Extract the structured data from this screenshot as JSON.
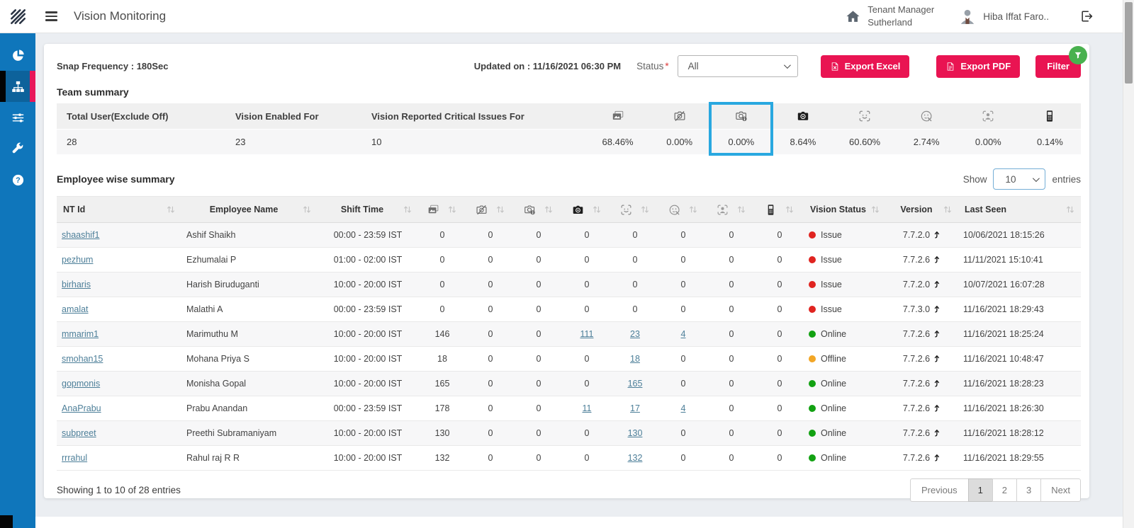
{
  "topbar": {
    "title": "Vision Monitoring",
    "tenant_line1": "Tenant Manager",
    "tenant_line2": "Sutherland",
    "user": "Hiba Iffat Faro.."
  },
  "sidebar": {
    "items": [
      {
        "name": "dashboard",
        "icon": "pie-chart-icon",
        "active": false
      },
      {
        "name": "team-monitoring",
        "icon": "sitemap-icon",
        "active": true
      },
      {
        "name": "configuration",
        "icon": "sliders-icon",
        "active": false
      },
      {
        "name": "tools",
        "icon": "wrench-icon",
        "active": false
      },
      {
        "name": "help",
        "icon": "help-icon",
        "active": false
      }
    ]
  },
  "toolbar": {
    "snap_frequency": "Snap Frequency : 180Sec",
    "updated_on": "Updated on : 11/16/2021 06:30 PM",
    "status_label": "Status",
    "required_mark": "*",
    "status_value": "All",
    "export_excel": "Export Excel",
    "export_pdf": "Export PDF",
    "filter": "Filter"
  },
  "team_summary": {
    "title": "Team summary",
    "columns": [
      {
        "type": "text",
        "label": "Total User(Exclude Off)",
        "value": "28"
      },
      {
        "type": "text",
        "label": "Vision Enabled For",
        "value": "23"
      },
      {
        "type": "text",
        "label": "Vision Reported Critical Issues For",
        "value": "10"
      },
      {
        "type": "icon",
        "icon": "photos-icon",
        "value": "68.46%"
      },
      {
        "type": "icon",
        "icon": "camera-off-icon",
        "value": "0.00%"
      },
      {
        "type": "icon",
        "icon": "camera-info-icon",
        "value": "0.00%",
        "highlighted": true
      },
      {
        "type": "icon",
        "icon": "camera-icon",
        "value": "8.64%"
      },
      {
        "type": "icon",
        "icon": "face-scan-icon",
        "value": "60.60%"
      },
      {
        "type": "icon",
        "icon": "face-issue-icon",
        "value": "2.74%"
      },
      {
        "type": "icon",
        "icon": "person-detect-icon",
        "value": "0.00%"
      },
      {
        "type": "icon",
        "icon": "mobile-icon",
        "value": "0.14%"
      }
    ]
  },
  "employee_table": {
    "title": "Employee wise summary",
    "show_label": "Show",
    "entries_label": "entries",
    "page_size": "10",
    "headers_left": [
      "NT Id",
      "Employee Name",
      "Shift Time"
    ],
    "icon_headers": [
      "photos-icon",
      "camera-off-icon",
      "camera-info-icon",
      "camera-icon",
      "face-scan-icon",
      "face-issue-icon",
      "person-detect-icon",
      "mobile-icon"
    ],
    "headers_right": [
      "Vision Status",
      "Version",
      "Last Seen"
    ],
    "rows": [
      {
        "nt_id": "shaashif1",
        "name": "Ashif Shaikh",
        "shift": "00:00 - 23:59 IST",
        "values": [
          "0",
          "0",
          "0",
          "0",
          "0",
          "0",
          "0",
          "0"
        ],
        "links": [],
        "status": {
          "label": "Issue",
          "state": "issue"
        },
        "version": "7.7.2.0",
        "last_seen": "10/06/2021 18:15:26"
      },
      {
        "nt_id": "pezhum",
        "name": "Ezhumalai P",
        "shift": "01:00 - 02:00 IST",
        "values": [
          "0",
          "0",
          "0",
          "0",
          "0",
          "0",
          "0",
          "0"
        ],
        "links": [],
        "status": {
          "label": "Issue",
          "state": "issue"
        },
        "version": "7.7.2.6",
        "last_seen": "11/11/2021 15:10:41"
      },
      {
        "nt_id": "birharis",
        "name": "Harish Biruduganti",
        "shift": "10:00 - 20:00 IST",
        "values": [
          "0",
          "0",
          "0",
          "0",
          "0",
          "0",
          "0",
          "0"
        ],
        "links": [],
        "status": {
          "label": "Issue",
          "state": "issue"
        },
        "version": "7.7.2.0",
        "last_seen": "10/07/2021 16:07:28"
      },
      {
        "nt_id": "amalat",
        "name": "Malathi A",
        "shift": "00:00 - 23:59 IST",
        "values": [
          "0",
          "0",
          "0",
          "0",
          "0",
          "0",
          "0",
          "0"
        ],
        "links": [],
        "status": {
          "label": "Issue",
          "state": "issue"
        },
        "version": "7.7.3.0",
        "last_seen": "11/16/2021 18:29:43"
      },
      {
        "nt_id": "mmarim1",
        "name": "Marimuthu M",
        "shift": "10:00 - 20:00 IST",
        "values": [
          "146",
          "0",
          "0",
          "111",
          "23",
          "4",
          "0",
          "0"
        ],
        "links": [
          3,
          4,
          5
        ],
        "status": {
          "label": "Online",
          "state": "online"
        },
        "version": "7.7.2.6",
        "last_seen": "11/16/2021 18:25:24"
      },
      {
        "nt_id": "smohan15",
        "name": "Mohana Priya S",
        "shift": "10:00 - 20:00 IST",
        "values": [
          "18",
          "0",
          "0",
          "0",
          "18",
          "0",
          "0",
          "0"
        ],
        "links": [
          4
        ],
        "status": {
          "label": "Offline",
          "state": "offline"
        },
        "version": "7.7.2.6",
        "last_seen": "11/16/2021 10:48:47"
      },
      {
        "nt_id": "gopmonis",
        "name": "Monisha Gopal",
        "shift": "10:00 - 20:00 IST",
        "values": [
          "165",
          "0",
          "0",
          "0",
          "165",
          "0",
          "0",
          "0"
        ],
        "links": [
          4
        ],
        "status": {
          "label": "Online",
          "state": "online"
        },
        "version": "7.7.2.6",
        "last_seen": "11/16/2021 18:28:23"
      },
      {
        "nt_id": "AnaPrabu",
        "name": "Prabu Anandan",
        "shift": "00:00 - 23:59 IST",
        "values": [
          "178",
          "0",
          "0",
          "11",
          "17",
          "4",
          "0",
          "0"
        ],
        "links": [
          3,
          4,
          5
        ],
        "status": {
          "label": "Online",
          "state": "online"
        },
        "version": "7.7.2.6",
        "last_seen": "11/16/2021 18:26:30"
      },
      {
        "nt_id": "subpreet",
        "name": "Preethi Subramaniyam",
        "shift": "10:00 - 20:00 IST",
        "values": [
          "130",
          "0",
          "0",
          "0",
          "130",
          "0",
          "0",
          "0"
        ],
        "links": [
          4
        ],
        "status": {
          "label": "Online",
          "state": "online"
        },
        "version": "7.7.2.6",
        "last_seen": "11/16/2021 18:28:12"
      },
      {
        "nt_id": "rrrahul",
        "name": "Rahul raj R R",
        "shift": "10:00 - 20:00 IST",
        "values": [
          "132",
          "0",
          "0",
          "0",
          "132",
          "0",
          "0",
          "0"
        ],
        "links": [
          4
        ],
        "status": {
          "label": "Online",
          "state": "online"
        },
        "version": "7.7.2.6",
        "last_seen": "11/16/2021 18:29:55"
      }
    ]
  },
  "footer": {
    "summary": "Showing 1 to 10 of 28 entries",
    "previous": "Previous",
    "pages": [
      "1",
      "2",
      "3"
    ],
    "active_page": "1",
    "next": "Next"
  },
  "colors": {
    "accent": "#e91452",
    "sidebar_blue": "#0f76bb",
    "highlight_blue": "#29a8e0",
    "link": "#4d7f99",
    "status": {
      "issue": "#e02420",
      "online": "#12a112",
      "offline": "#f2a626"
    }
  }
}
